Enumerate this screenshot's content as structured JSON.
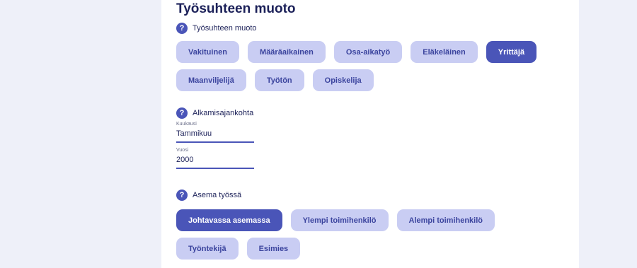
{
  "employment": {
    "title": "Työsuhteen muoto",
    "question_label": "Työsuhteen muoto",
    "options": [
      "Vakituinen",
      "Määräaikainen",
      "Osa-aikatyö",
      "Eläkeläinen",
      "Yrittäjä",
      "Maanviljelijä",
      "Työtön",
      "Opiskelija"
    ],
    "selected": "Yrittäjä"
  },
  "start": {
    "question_label": "Alkamisajankohta",
    "month_label": "Kuukausi",
    "month_value": "Tammikuu",
    "year_label": "Vuosi",
    "year_value": "2000"
  },
  "position": {
    "question_label": "Asema työssä",
    "options": [
      "Johtavassa asemassa",
      "Ylempi toimihenkilö",
      "Alempi toimihenkilö",
      "Työntekijä",
      "Esimies"
    ],
    "selected": "Johtavassa asemassa"
  },
  "help_icon_glyph": "?",
  "colors": {
    "accent": "#4a55b8",
    "chip": "#c9cdf3",
    "text": "#1c2159",
    "background": "#eef0f9"
  }
}
